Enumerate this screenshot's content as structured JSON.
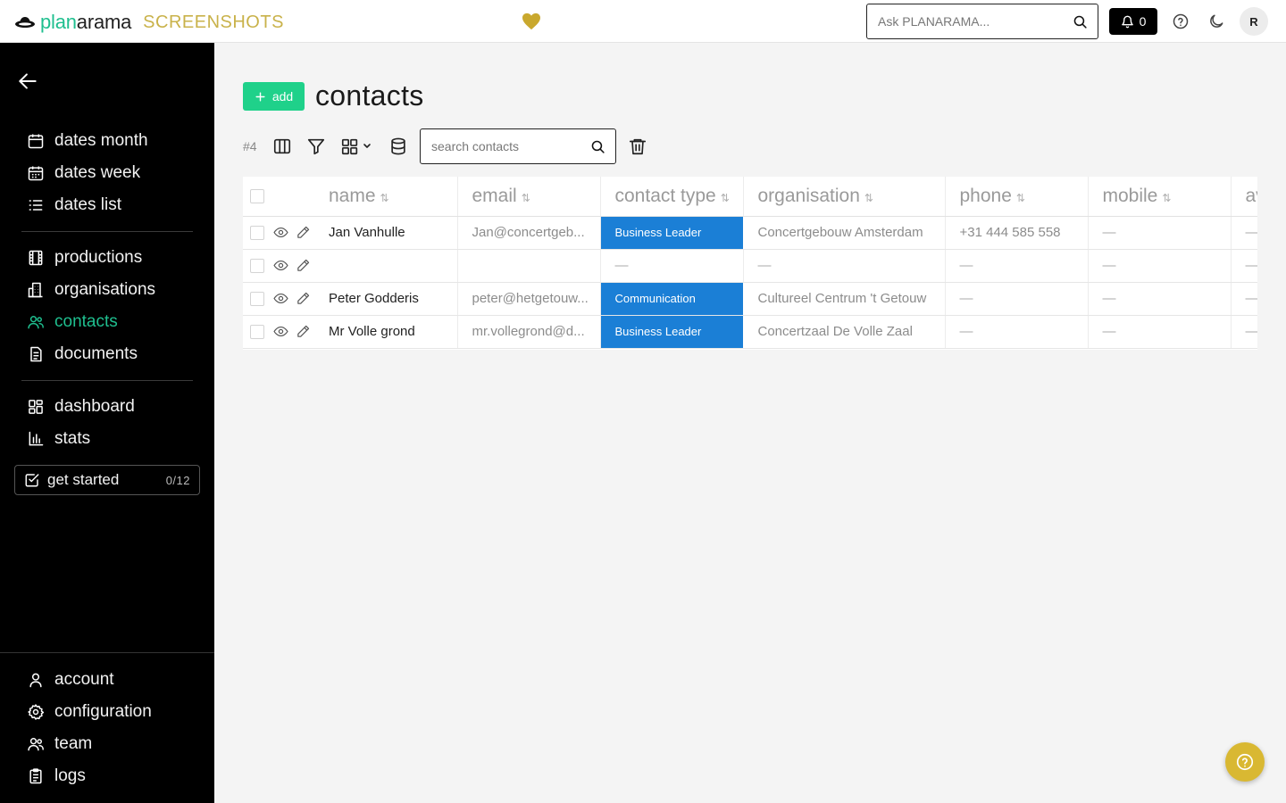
{
  "topbar": {
    "brand_plan": "plan",
    "brand_rest": "arama",
    "brand_tag": "SCREENSHOTS",
    "ask_placeholder": "Ask PLANARAMA...",
    "notification_count": "0",
    "avatar_initial": "R",
    "heart_color": "#c9a82e"
  },
  "sidebar": {
    "nav_groups": [
      [
        {
          "label": "dates month",
          "icon": "calendar-month-icon"
        },
        {
          "label": "dates week",
          "icon": "calendar-week-icon"
        },
        {
          "label": "dates list",
          "icon": "list-icon"
        }
      ],
      [
        {
          "label": "productions",
          "icon": "film-icon"
        },
        {
          "label": "organisations",
          "icon": "building-icon"
        },
        {
          "label": "contacts",
          "icon": "users-icon",
          "active": true
        },
        {
          "label": "documents",
          "icon": "document-icon"
        }
      ],
      [
        {
          "label": "dashboard",
          "icon": "grid-icon"
        },
        {
          "label": "stats",
          "icon": "bar-chart-icon"
        }
      ]
    ],
    "get_started": {
      "label": "get started",
      "count": "0/12"
    },
    "bottom_items": [
      {
        "label": "account",
        "icon": "user-icon"
      },
      {
        "label": "configuration",
        "icon": "gear-icon"
      },
      {
        "label": "team",
        "icon": "team-icon"
      },
      {
        "label": "logs",
        "icon": "clipboard-icon"
      }
    ],
    "active_color": "#1fbf8f"
  },
  "main": {
    "add_label": "add",
    "title": "contacts",
    "count": "#4",
    "search_placeholder": "search contacts",
    "accent_color": "#1fd18a"
  },
  "table": {
    "columns": [
      "name",
      "email",
      "contact type",
      "organisation",
      "phone",
      "mobile",
      "av"
    ],
    "rows": [
      {
        "name": "Jan Vanhulle",
        "email": "Jan@concertgeb...",
        "contact_type": "Business Leader",
        "organisation": "Concertgebouw Amsterdam",
        "phone": "+31 444 585 558",
        "mobile": "—",
        "extra": "—"
      },
      {
        "name": "",
        "email": "",
        "contact_type": "—",
        "organisation": "—",
        "phone": "—",
        "mobile": "—",
        "extra": "—"
      },
      {
        "name": "Peter Godderis",
        "email": "peter@hetgetouw...",
        "contact_type": "Communication",
        "organisation": "Cultureel Centrum 't Getouw",
        "phone": "—",
        "mobile": "—",
        "extra": "—"
      },
      {
        "name": "Mr Volle grond",
        "email": "mr.vollegrond@d...",
        "contact_type": "Business Leader",
        "organisation": "Concertzaal De Volle Zaal",
        "phone": "—",
        "mobile": "—",
        "extra": "—"
      }
    ],
    "badge_color": "#1b7fd6"
  },
  "help_fab_color": "#d9b832"
}
